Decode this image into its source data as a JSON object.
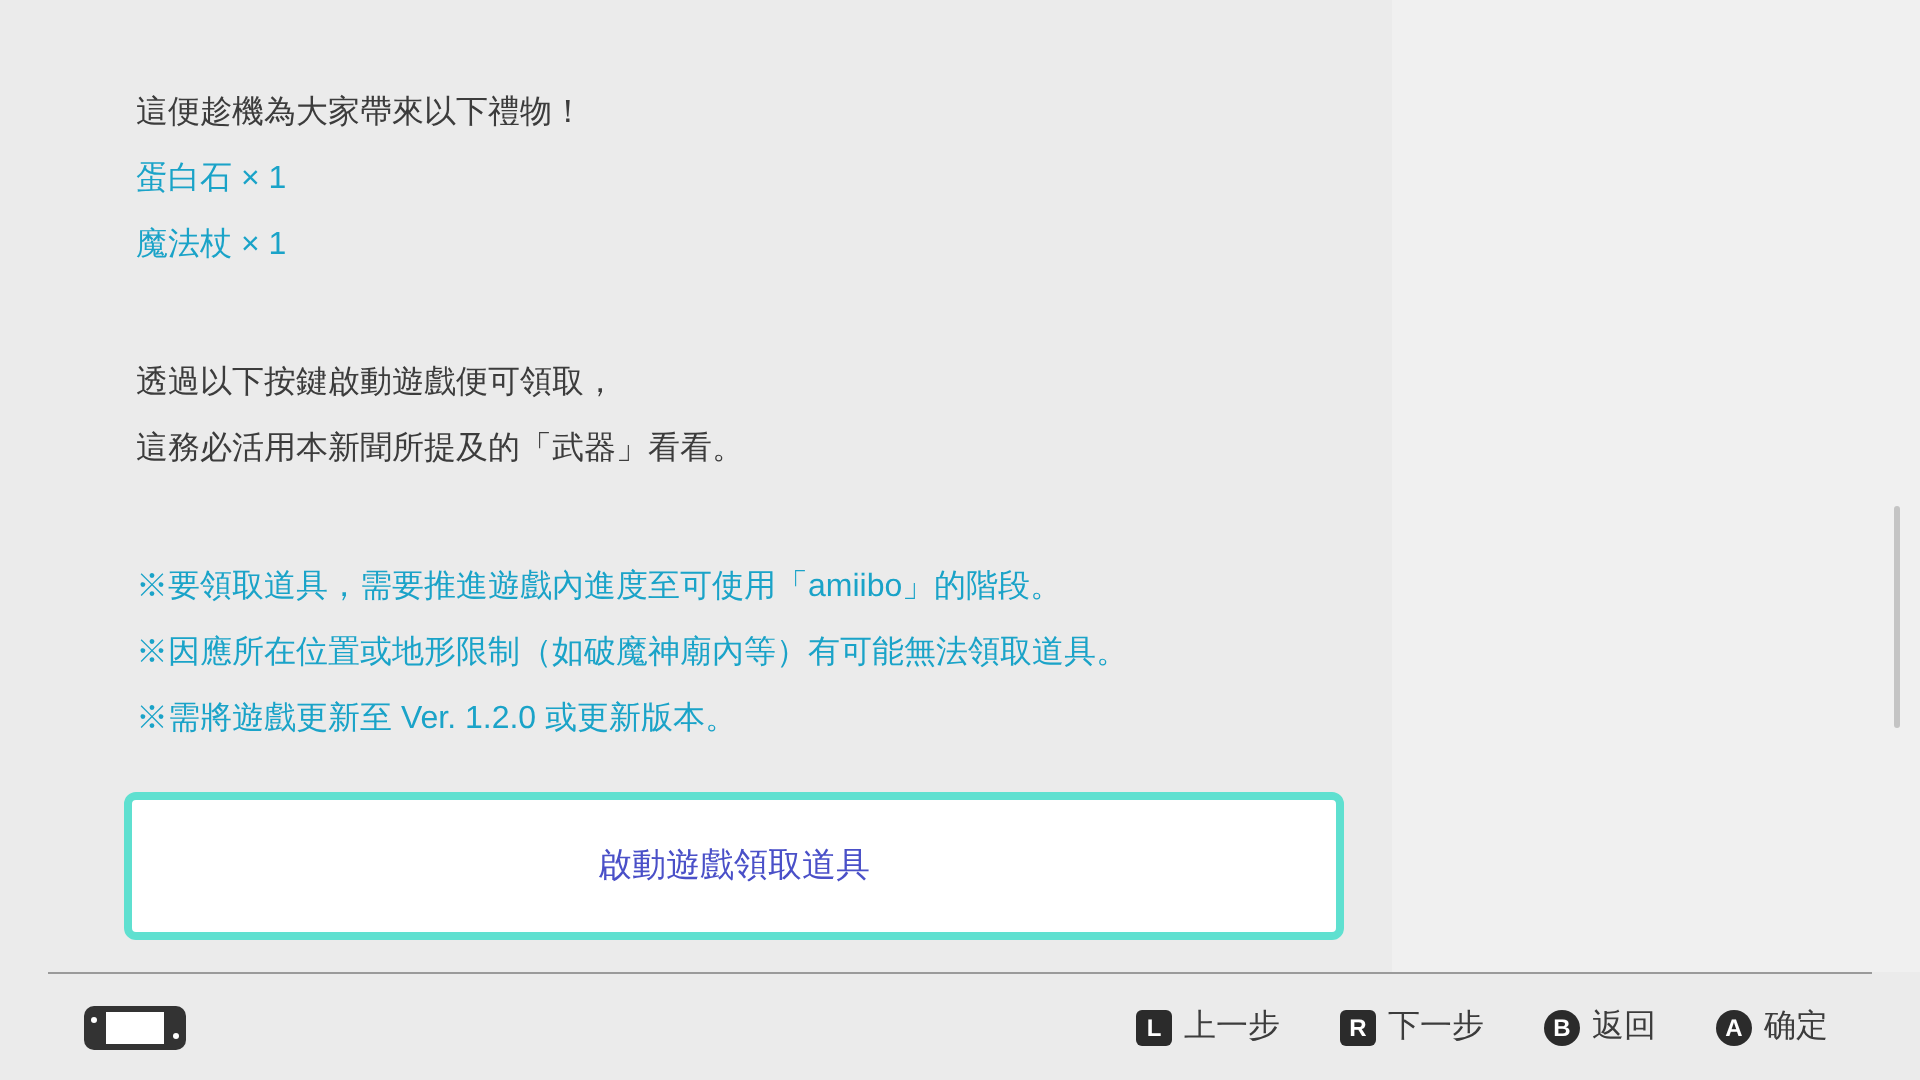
{
  "sections": [
    {
      "lines": [
        {
          "text": "這便趁機為大家帶來以下禮物！",
          "kind": "plain"
        },
        {
          "text": "蛋白石 × 1",
          "kind": "highlight"
        },
        {
          "text": "魔法杖 × 1",
          "kind": "highlight"
        }
      ]
    },
    {
      "lines": [
        {
          "text": "透過以下按鍵啟動遊戲便可領取，",
          "kind": "plain"
        },
        {
          "text": "這務必活用本新聞所提及的「武器」看看。",
          "kind": "plain"
        }
      ]
    },
    {
      "lines": [
        {
          "text": "※要領取道具，需要推進遊戲內進度至可使用「amiibo」的階段。",
          "kind": "highlight"
        },
        {
          "text": "※因應所在位置或地形限制（如破魔神廟內等）有可能無法領取道具。",
          "kind": "highlight"
        },
        {
          "text": "※需將遊戲更新至 Ver. 1.2.0 或更新版本。",
          "kind": "highlight"
        }
      ]
    }
  ],
  "action_button": {
    "label": "啟動遊戲領取道具",
    "selected": true
  },
  "footer": {
    "hints": [
      {
        "key": "L",
        "kind": "square",
        "label": "上一步"
      },
      {
        "key": "R",
        "kind": "square",
        "label": "下一步"
      },
      {
        "key": "B",
        "kind": "round",
        "label": "返回"
      },
      {
        "key": "A",
        "kind": "round",
        "label": "确定"
      }
    ]
  }
}
